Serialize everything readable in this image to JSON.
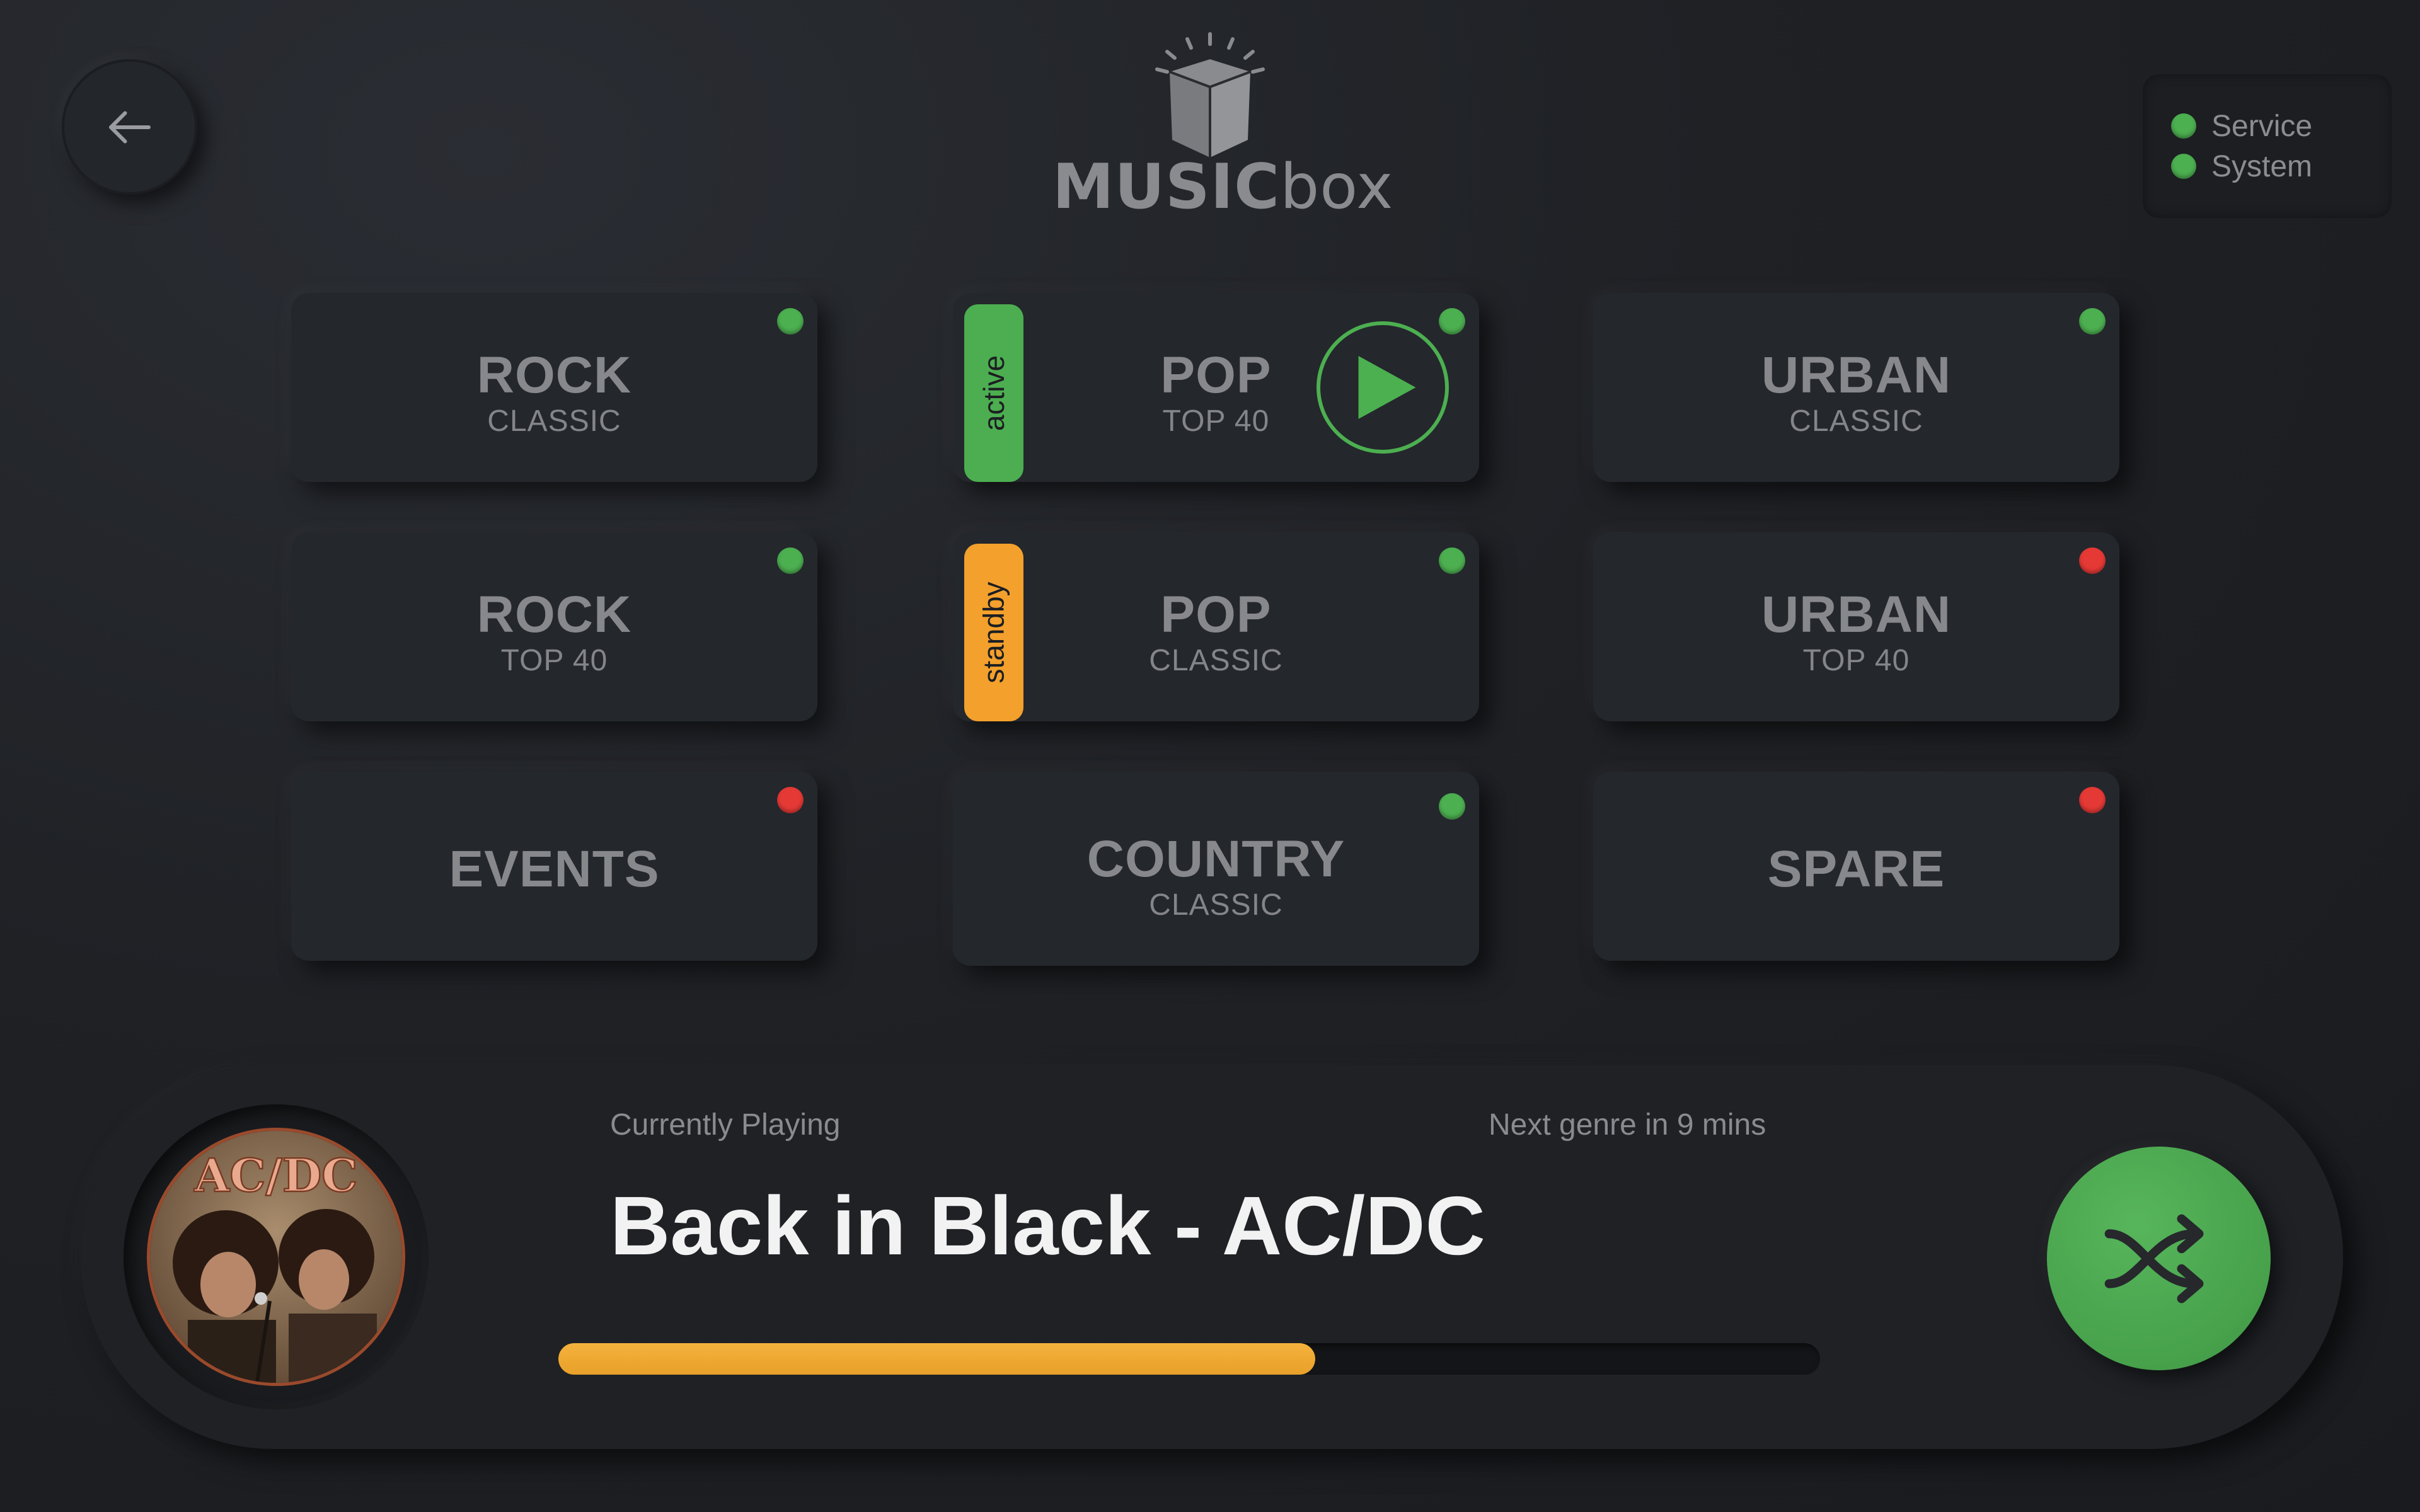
{
  "app": {
    "logo_main": "MUSIC",
    "logo_sub": "box"
  },
  "status": {
    "items": [
      {
        "label": "Service",
        "color": "#4caf50"
      },
      {
        "label": "System",
        "color": "#4caf50"
      }
    ]
  },
  "genres": [
    {
      "title": "ROCK",
      "subtitle": "CLASSIC",
      "status": "green"
    },
    {
      "title": "POP",
      "subtitle": "TOP 40",
      "status": "green",
      "tag": "active"
    },
    {
      "title": "URBAN",
      "subtitle": "CLASSIC",
      "status": "green"
    },
    {
      "title": "ROCK",
      "subtitle": "TOP 40",
      "status": "green"
    },
    {
      "title": "POP",
      "subtitle": "CLASSIC",
      "status": "green",
      "tag": "standby"
    },
    {
      "title": "URBAN",
      "subtitle": "TOP 40",
      "status": "red"
    },
    {
      "title": "EVENTS",
      "subtitle": "",
      "status": "red"
    },
    {
      "title": "COUNTRY",
      "subtitle": "CLASSIC",
      "status": "green"
    },
    {
      "title": "SPARE",
      "subtitle": "",
      "status": "red"
    }
  ],
  "player": {
    "album_text": "AC/DC",
    "currently_playing_label": "Currently Playing",
    "next_genre_label": "Next genre in 9 mins",
    "track": "Back in Black - AC/DC",
    "progress_percent": 60
  },
  "colors": {
    "accent_green": "#4caf50",
    "accent_orange": "#f3a02c",
    "status_red": "#e53935",
    "progress": "#f0aa34"
  }
}
